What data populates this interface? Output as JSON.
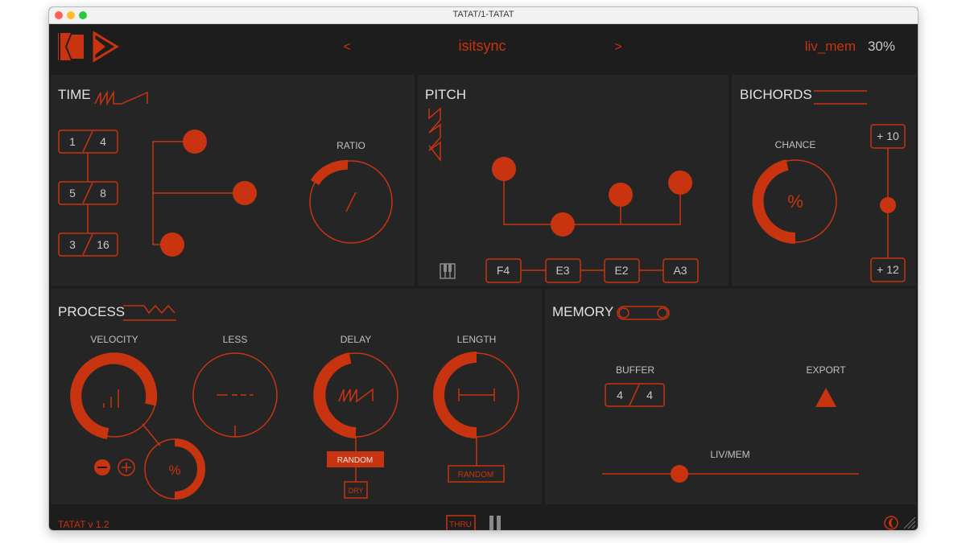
{
  "window": {
    "title": "TATAT/1-TATAT"
  },
  "header": {
    "prev": "<",
    "preset": "isitsync",
    "next": ">",
    "memory_name": "liv_mem",
    "memory_pct": "30%"
  },
  "time": {
    "title": "TIME",
    "ratios": [
      {
        "num": "1",
        "den": "4"
      },
      {
        "num": "5",
        "den": "8"
      },
      {
        "num": "3",
        "den": "16"
      }
    ],
    "ratio_label": "RATIO"
  },
  "pitch": {
    "title": "PITCH",
    "notes": [
      "F4",
      "E3",
      "E2",
      "A3"
    ]
  },
  "bichords": {
    "title": "BICHORDS",
    "chance_label": "CHANCE",
    "chance_symbol": "%",
    "top_value": "+ 10",
    "bottom_value": "+ 12"
  },
  "process": {
    "title": "PROCESS",
    "velocity_label": "VELOCITY",
    "less_label": "LESS",
    "delay_label": "DELAY",
    "length_label": "LENGTH",
    "velocity_pct_symbol": "%",
    "delay_random": "RANDOM",
    "delay_dry": "DRY",
    "length_random": "RANDOM"
  },
  "memory": {
    "title": "MEMORY",
    "buffer_label": "BUFFER",
    "buffer_num": "4",
    "buffer_den": "4",
    "export_label": "EXPORT",
    "livmem_label": "LIV/MEM"
  },
  "footer": {
    "version": "TATAT v 1.2",
    "thru": "THRU"
  },
  "colors": {
    "accent": "#c8340f",
    "panel": "#252525",
    "background": "#1d1d1d"
  }
}
